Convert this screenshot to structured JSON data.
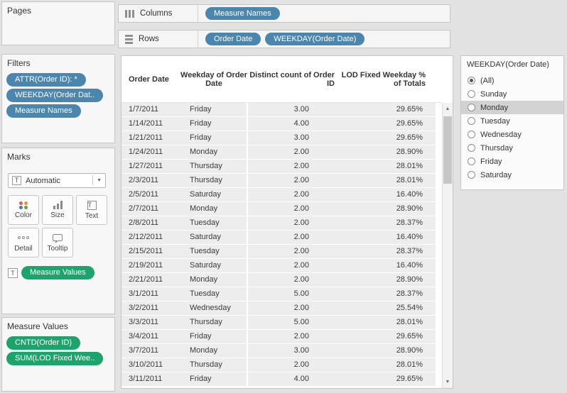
{
  "colors": {
    "pill_blue": "#4a86ad",
    "pill_green": "#1fa36c",
    "highlight": "#d2d2d2"
  },
  "pages": {
    "title": "Pages"
  },
  "shelves": {
    "columns": {
      "label": "Columns",
      "pills": [
        "Measure Names"
      ]
    },
    "rows": {
      "label": "Rows",
      "pills": [
        "Order Date",
        "WEEKDAY(Order Date)"
      ]
    }
  },
  "filters": {
    "title": "Filters",
    "pills": [
      "ATTR(Order ID): *",
      "WEEKDAY(Order Dat..",
      "Measure Names"
    ]
  },
  "marks": {
    "title": "Marks",
    "mark_type": "Automatic",
    "buttons": [
      {
        "label": "Color"
      },
      {
        "label": "Size"
      },
      {
        "label": "Text"
      },
      {
        "label": "Detail"
      },
      {
        "label": "Tooltip"
      }
    ],
    "pill": "Measure Values"
  },
  "measure_values": {
    "title": "Measure Values",
    "pills": [
      "CNTD(Order ID)",
      "SUM(LOD Fixed Wee.."
    ]
  },
  "table": {
    "headers": [
      "Order Date",
      "Weekday of Order Date",
      "Distinct count of Order ID",
      "LOD Fixed Weekday % of Totals"
    ],
    "rows": [
      [
        "1/7/2011",
        "Friday",
        "3.00",
        "29.65%"
      ],
      [
        "1/14/2011",
        "Friday",
        "4.00",
        "29.65%"
      ],
      [
        "1/21/2011",
        "Friday",
        "3.00",
        "29.65%"
      ],
      [
        "1/24/2011",
        "Monday",
        "2.00",
        "28.90%"
      ],
      [
        "1/27/2011",
        "Thursday",
        "2.00",
        "28.01%"
      ],
      [
        "2/3/2011",
        "Thursday",
        "2.00",
        "28.01%"
      ],
      [
        "2/5/2011",
        "Saturday",
        "2.00",
        "16.40%"
      ],
      [
        "2/7/2011",
        "Monday",
        "2.00",
        "28.90%"
      ],
      [
        "2/8/2011",
        "Tuesday",
        "2.00",
        "28.37%"
      ],
      [
        "2/12/2011",
        "Saturday",
        "2.00",
        "16.40%"
      ],
      [
        "2/15/2011",
        "Tuesday",
        "2.00",
        "28.37%"
      ],
      [
        "2/19/2011",
        "Saturday",
        "2.00",
        "16.40%"
      ],
      [
        "2/21/2011",
        "Monday",
        "2.00",
        "28.90%"
      ],
      [
        "3/1/2011",
        "Tuesday",
        "5.00",
        "28.37%"
      ],
      [
        "3/2/2011",
        "Wednesday",
        "2.00",
        "25.54%"
      ],
      [
        "3/3/2011",
        "Thursday",
        "5.00",
        "28.01%"
      ],
      [
        "3/4/2011",
        "Friday",
        "2.00",
        "29.65%"
      ],
      [
        "3/7/2011",
        "Monday",
        "3.00",
        "28.90%"
      ],
      [
        "3/10/2011",
        "Thursday",
        "2.00",
        "28.01%"
      ],
      [
        "3/11/2011",
        "Friday",
        "4.00",
        "29.65%"
      ]
    ]
  },
  "weekday_filter": {
    "title": "WEEKDAY(Order Date)",
    "options": [
      {
        "label": "(All)",
        "selected": true,
        "highlighted": false
      },
      {
        "label": "Sunday",
        "selected": false,
        "highlighted": false
      },
      {
        "label": "Monday",
        "selected": false,
        "highlighted": true
      },
      {
        "label": "Tuesday",
        "selected": false,
        "highlighted": false
      },
      {
        "label": "Wednesday",
        "selected": false,
        "highlighted": false
      },
      {
        "label": "Thursday",
        "selected": false,
        "highlighted": false
      },
      {
        "label": "Friday",
        "selected": false,
        "highlighted": false
      },
      {
        "label": "Saturday",
        "selected": false,
        "highlighted": false
      }
    ]
  }
}
